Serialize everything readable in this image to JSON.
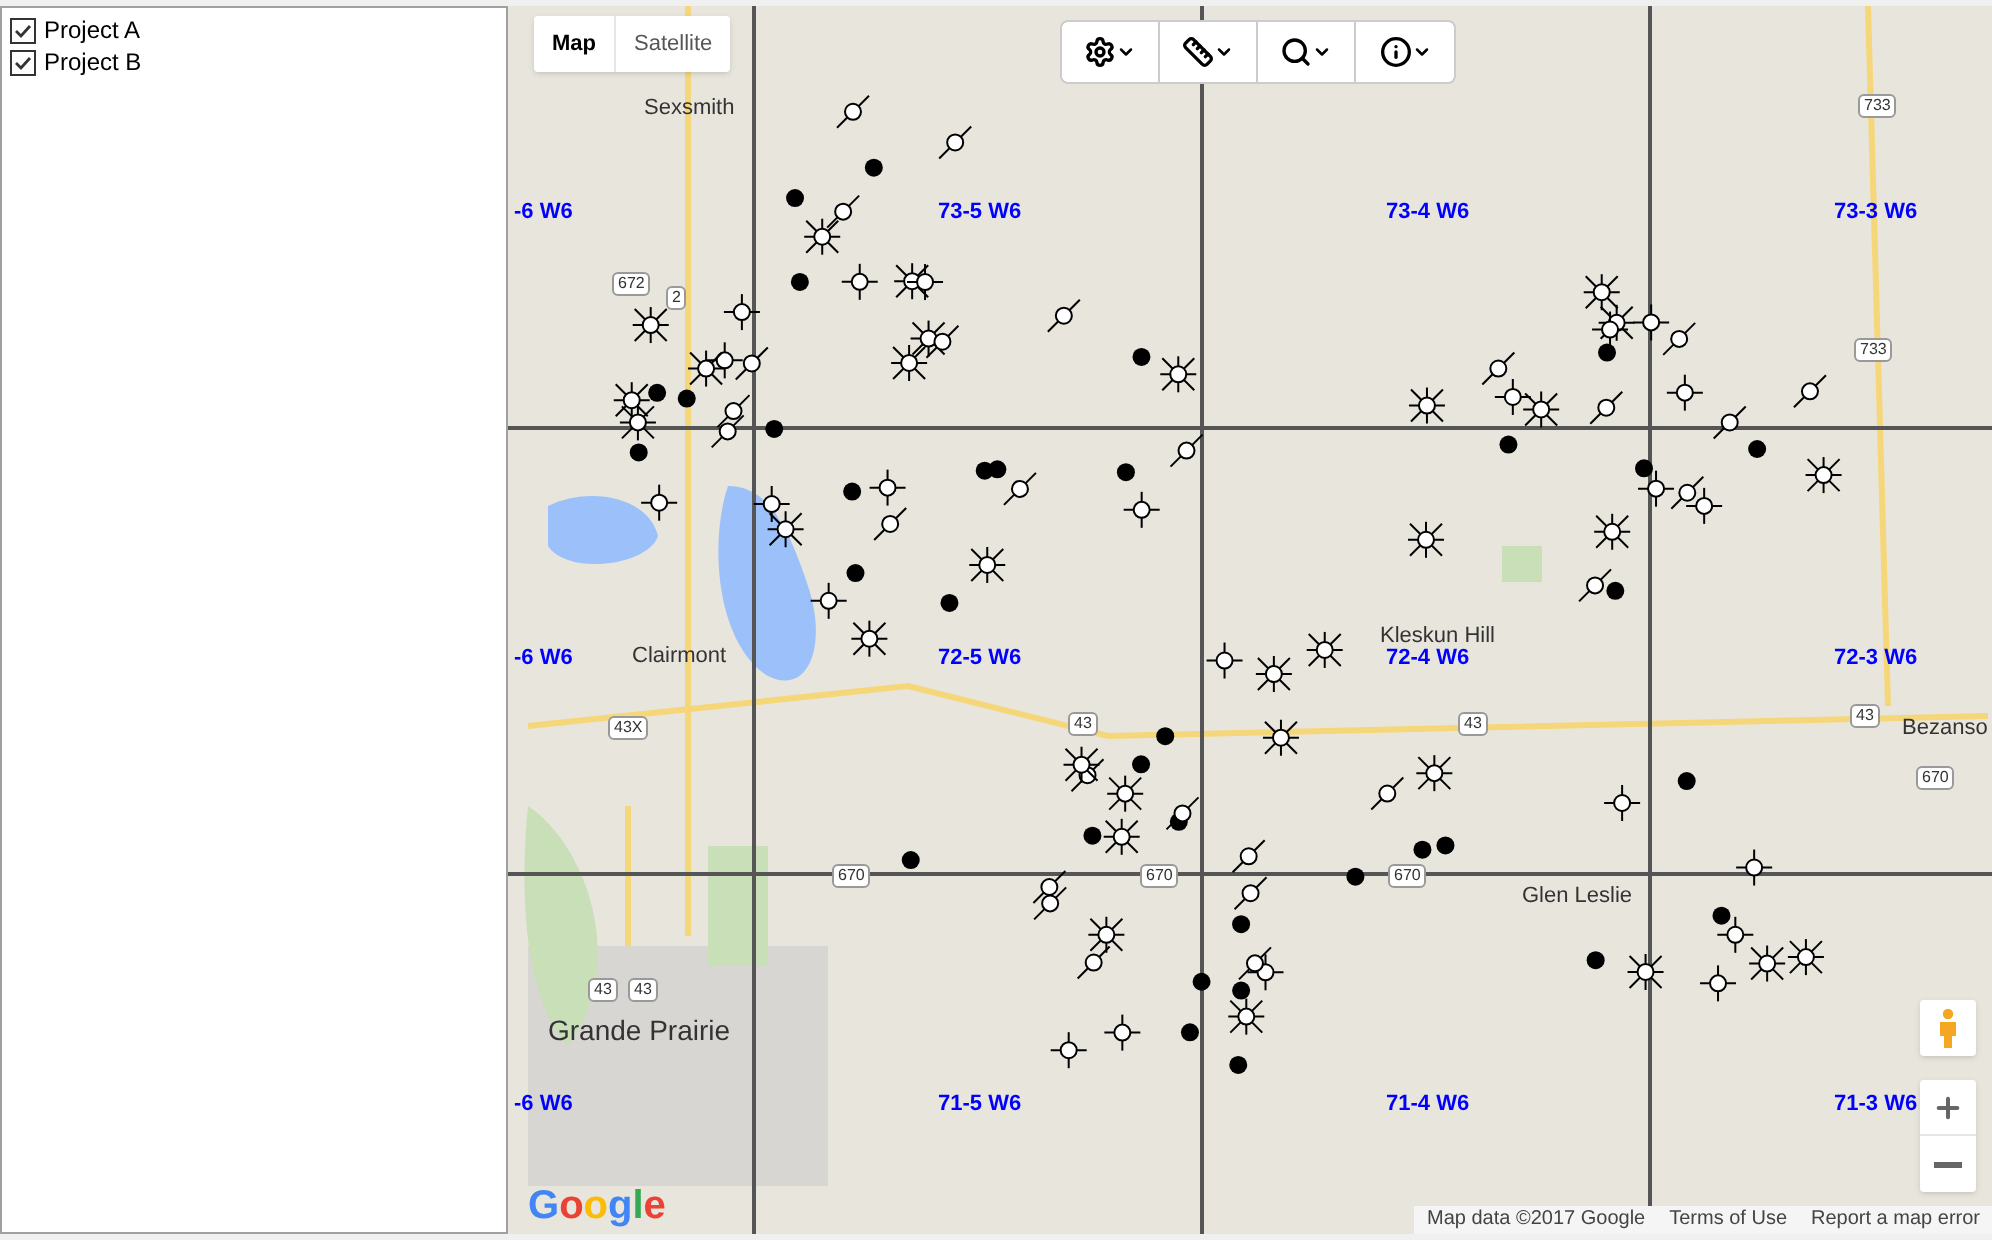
{
  "sidebar": {
    "projects": [
      {
        "label": "Project A",
        "checked": true
      },
      {
        "label": "Project B",
        "checked": true
      }
    ]
  },
  "map": {
    "map_types": [
      {
        "label": "Map",
        "selected": true
      },
      {
        "label": "Satellite",
        "selected": false
      }
    ],
    "township_labels": [
      "-6 W6",
      "73-5 W6",
      "73-4 W6",
      "73-3 W6",
      "-6 W6",
      "72-5 W6",
      "72-4 W6",
      "72-3 W6",
      "-6 W6",
      "71-5 W6",
      "71-4 W6",
      "71-3 W6"
    ],
    "place_labels": [
      "Sexsmith",
      "Clairmont",
      "Kleskun Hill",
      "Glen Leslie",
      "Grande Prairie",
      "Bezanso"
    ],
    "road_shields": [
      "733",
      "672",
      "2",
      "733",
      "43X",
      "43",
      "43",
      "43",
      "670",
      "670",
      "670",
      "670",
      "43",
      "43"
    ],
    "logo": "Google",
    "attribution": [
      "Map data ©2017 Google",
      "Terms of Use",
      "Report a map error"
    ]
  }
}
